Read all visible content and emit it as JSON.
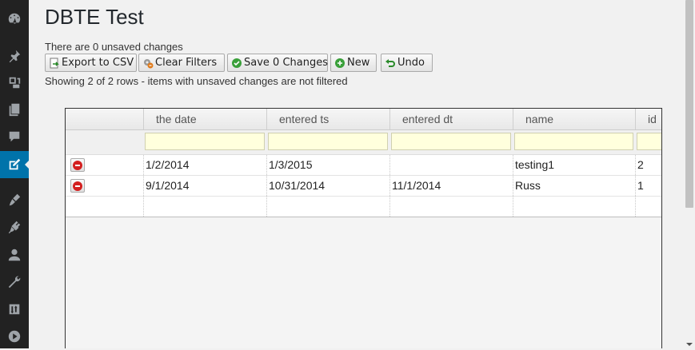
{
  "page": {
    "title": "DBTE Test",
    "unsaved_message": "There are 0 unsaved changes",
    "showing_message": "Showing 2 of 2 rows - items with unsaved changes are not filtered"
  },
  "sidebar": {
    "items": [
      {
        "icon": "dashboard-icon",
        "active": false
      },
      {
        "icon": "pin-icon",
        "active": false
      },
      {
        "icon": "media-icon",
        "active": false
      },
      {
        "icon": "pages-icon",
        "active": false
      },
      {
        "icon": "comments-icon",
        "active": false
      },
      {
        "icon": "edit-icon",
        "active": true
      },
      {
        "icon": "appearance-icon",
        "active": false
      },
      {
        "icon": "plugins-icon",
        "active": false
      },
      {
        "icon": "users-icon",
        "active": false
      },
      {
        "icon": "tools-icon",
        "active": false
      },
      {
        "icon": "settings-icon",
        "active": false
      },
      {
        "icon": "play-icon",
        "active": false
      }
    ]
  },
  "toolbar": {
    "export_label": "Export to CSV",
    "clear_filters_label": "Clear Filters",
    "save_label": "Save 0 Changes",
    "new_label": "New",
    "undo_label": "Undo"
  },
  "grid": {
    "columns": [
      "the date",
      "entered ts",
      "entered dt",
      "name",
      "id"
    ],
    "filters": [
      "",
      "",
      "",
      "",
      ""
    ],
    "rows": [
      [
        "1/2/2014",
        "1/3/2015",
        "",
        "testing1",
        "2"
      ],
      [
        "9/1/2014",
        "10/31/2014",
        "11/1/2014",
        "Russ",
        "1"
      ]
    ]
  },
  "colors": {
    "sidebar_bg": "#222222",
    "sidebar_active": "#0073aa",
    "filter_bg": "#ffffdd",
    "delete_red": "#d32020"
  }
}
